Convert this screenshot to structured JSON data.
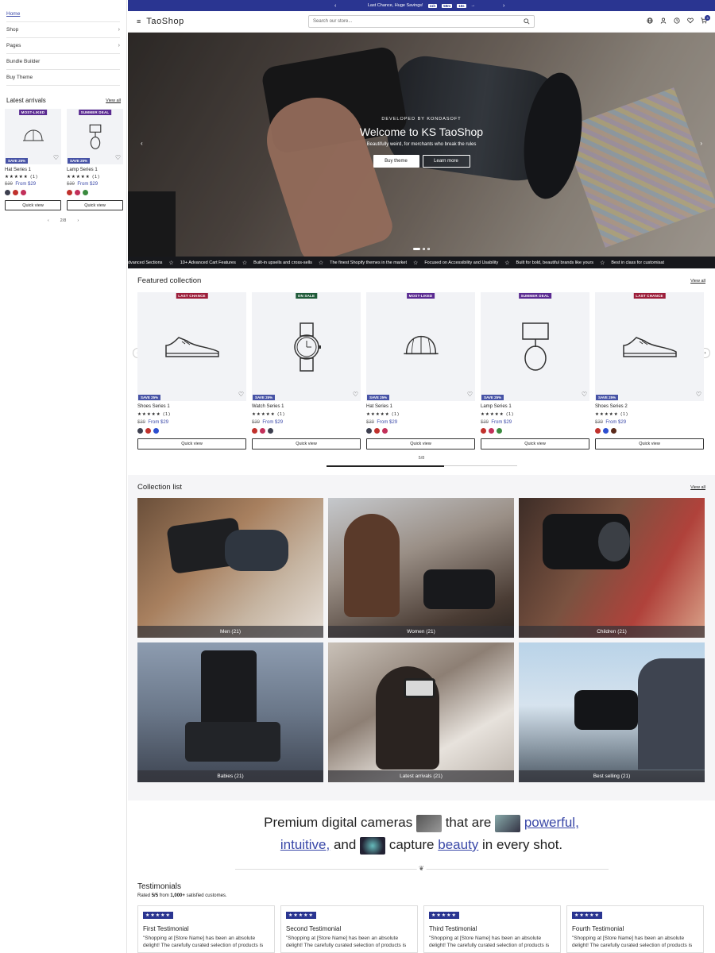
{
  "drawer": {
    "nav": [
      {
        "label": "Home",
        "active": true,
        "has_children": false
      },
      {
        "label": "Shop",
        "active": false,
        "has_children": true
      },
      {
        "label": "Pages",
        "active": false,
        "has_children": true
      },
      {
        "label": "Bundle Builder",
        "active": false,
        "has_children": false
      },
      {
        "label": "Buy Theme",
        "active": false,
        "has_children": false
      }
    ],
    "latest_title": "Latest arrivals",
    "view_all": "View all",
    "products": [
      {
        "badge": "MOST-LIKED",
        "badge_color": "#5a2a91",
        "save": "SAVE 25%",
        "name": "Hat Series 1",
        "stars": "★★★★★",
        "reviews": "(1)",
        "old_price": "$39",
        "price": "From $29",
        "icon": "cap-icon",
        "swatches": [
          "#3d3f4f",
          "#c0312c",
          "#c2305a"
        ],
        "quick_view": "Quick view"
      },
      {
        "badge": "SUMMER DEAL",
        "badge_color": "#5a2a91",
        "save": "SAVE 25%",
        "name": "Lamp Series 1",
        "stars": "★★★★★",
        "reviews": "(1)",
        "old_price": "$39",
        "price": "From $29",
        "icon": "lamp-icon",
        "swatches": [
          "#c0312c",
          "#c2305a",
          "#3a8a3e"
        ],
        "quick_view": "Quick view"
      }
    ],
    "pager": "2/8"
  },
  "announcement": {
    "text": "Last Chance, Huge Savings!",
    "timer": [
      "11h",
      "58m",
      "18s"
    ]
  },
  "header": {
    "logo": "TaoShop",
    "search_placeholder": "Search our store...",
    "cart_count": "3"
  },
  "hero": {
    "eyebrow": "DEVELOPED BY KONDASOFT",
    "title": "Welcome to KS TaoShop",
    "subtitle": "Beautifully weird, for merchants who break the rules",
    "btn_primary": "Buy theme",
    "btn_secondary": "Learn more",
    "active_slide": 1,
    "slide_count": 3
  },
  "marquee": [
    "dvanced Sections",
    "10+ Advanced Cart Features",
    "Built-in upsells and cross-sells",
    "The finest Shopify themes in the market",
    "Focused on Accessibility and Usability",
    "Built for bold, beautiful brands like yours",
    "Best in class for customisat"
  ],
  "featured": {
    "title": "Featured collection",
    "view_all": "View all",
    "products": [
      {
        "badge": "LAST CHANCE",
        "badge_color": "#9c1e3a",
        "save": "SAVE 25%",
        "name": "Shoes Series 1",
        "stars": "★★★★★",
        "reviews": "(1)",
        "old_price": "$39",
        "price": "From $29",
        "icon": "shoe-icon",
        "swatches": [
          "#3d3f4f",
          "#c0312c",
          "#2d4fd0"
        ],
        "quick_view": "Quick view"
      },
      {
        "badge": "ON SALE",
        "badge_color": "#1e5a38",
        "save": "SAVE 25%",
        "name": "Watch Series 1",
        "stars": "★★★★★",
        "reviews": "(1)",
        "old_price": "$39",
        "price": "From $29",
        "icon": "watch-icon",
        "swatches": [
          "#c0312c",
          "#c2305a",
          "#3d3f4f"
        ],
        "quick_view": "Quick view"
      },
      {
        "badge": "MOST-LIKED",
        "badge_color": "#5a2a91",
        "save": "SAVE 25%",
        "name": "Hat Series 1",
        "stars": "★★★★★",
        "reviews": "(1)",
        "old_price": "$39",
        "price": "From $29",
        "icon": "cap-icon",
        "swatches": [
          "#3d3f4f",
          "#c0312c",
          "#c2305a"
        ],
        "quick_view": "Quick view"
      },
      {
        "badge": "SUMMER DEAL",
        "badge_color": "#5a2a91",
        "save": "SAVE 25%",
        "name": "Lamp Series 1",
        "stars": "★★★★★",
        "reviews": "(1)",
        "old_price": "$39",
        "price": "From $29",
        "icon": "lamp-icon",
        "swatches": [
          "#c0312c",
          "#c2305a",
          "#3a8a3e"
        ],
        "quick_view": "Quick view"
      },
      {
        "badge": "LAST CHANCE",
        "badge_color": "#9c1e3a",
        "save": "SAVE 25%",
        "name": "Shoes Series 2",
        "stars": "★★★★★",
        "reviews": "(1)",
        "old_price": "$39",
        "price": "From $29",
        "icon": "shoe-icon",
        "swatches": [
          "#c0312c",
          "#2d4fd0",
          "#5a2a1a"
        ],
        "quick_view": "Quick view"
      }
    ],
    "pager": "5/8",
    "progress": 0.62
  },
  "collections": {
    "title": "Collection list",
    "view_all": "View all",
    "items": [
      {
        "label": "Men (21)"
      },
      {
        "label": "Women (21)"
      },
      {
        "label": "Children (21)"
      },
      {
        "label": "Babies (21)"
      },
      {
        "label": "Latest arrivals (21)"
      },
      {
        "label": "Best selling (21)"
      }
    ]
  },
  "tagline": {
    "part1": "Premium digital cameras",
    "part2": "that are",
    "hl1": "powerful,",
    "hl2": "intuitive,",
    "part3": "and",
    "part4": "capture",
    "hl3": "beauty",
    "part5": "in every shot."
  },
  "testimonials": {
    "title": "Testimonials",
    "rated_prefix": "Rated ",
    "rating": "5/5",
    "rated_mid": " from ",
    "count": "1,000+",
    "rated_suffix": " satisfied customes.",
    "items": [
      {
        "stars": "★★★★★",
        "name": "First Testimonial",
        "body": "\"Shopping at [Store Name] has been an absolute delight! The carefully curated selection of products is"
      },
      {
        "stars": "★★★★★",
        "name": "Second Testimonial",
        "body": "\"Shopping at [Store Name] has been an absolute delight! The carefully curated selection of products is"
      },
      {
        "stars": "★★★★★",
        "name": "Third Testimonial",
        "body": "\"Shopping at [Store Name] has been an absolute delight! The carefully curated selection of products is"
      },
      {
        "stars": "★★★★★",
        "name": "Fourth Testimonial",
        "body": "\"Shopping at [Store Name] has been an absolute delight! The carefully curated selection of products is"
      }
    ]
  }
}
